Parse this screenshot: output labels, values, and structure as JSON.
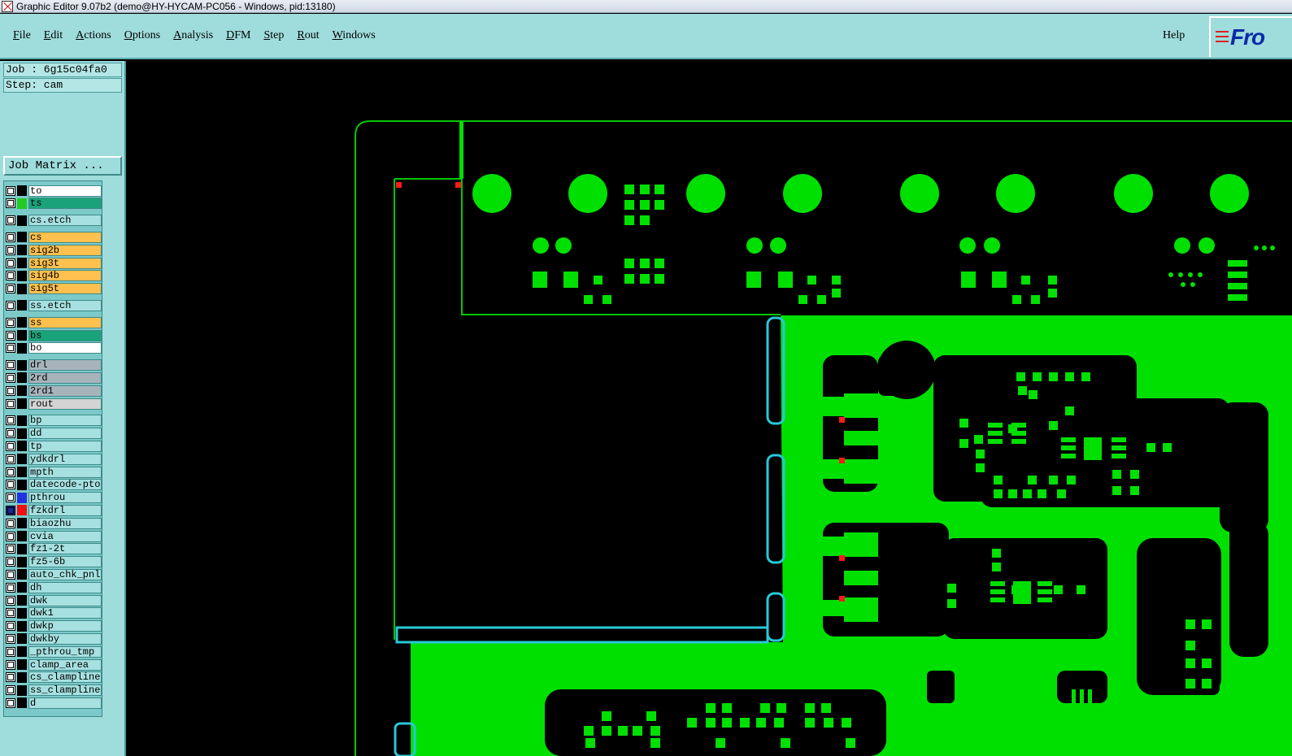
{
  "window": {
    "title": "Graphic Editor 9.07b2 (demo@HY-HYCAM-PC056 - Windows, pid:13180)"
  },
  "menu": {
    "items": [
      "File",
      "Edit",
      "Actions",
      "Options",
      "Analysis",
      "DFM",
      "Step",
      "Rout",
      "Windows"
    ],
    "help": "Help",
    "logo": "Fro"
  },
  "job": {
    "job_line": "Job : 6g15c04fa0",
    "step_line": "Step: cam",
    "matrix_button": "Job Matrix ..."
  },
  "layers": [
    {
      "name": "to",
      "swatch": "#000000",
      "bg": "#ffffff",
      "group_gap": false
    },
    {
      "name": "ts",
      "swatch": "#22cc22",
      "bg": "#1aa37a",
      "group_gap": false
    },
    {
      "name": "cs.etch",
      "swatch": "",
      "bg": "#a6e0e0",
      "group_gap": true
    },
    {
      "name": "cs",
      "swatch": "",
      "bg": "#ffc04d",
      "group_gap": true
    },
    {
      "name": "sig2b",
      "swatch": "",
      "bg": "#ffc04d",
      "group_gap": false
    },
    {
      "name": "sig3t",
      "swatch": "",
      "bg": "#ffc04d",
      "group_gap": false
    },
    {
      "name": "sig4b",
      "swatch": "",
      "bg": "#ffc04d",
      "group_gap": false
    },
    {
      "name": "sig5t",
      "swatch": "",
      "bg": "#ffc04d",
      "group_gap": false
    },
    {
      "name": "ss.etch",
      "swatch": "",
      "bg": "#a6e0e0",
      "group_gap": true
    },
    {
      "name": "ss",
      "swatch": "",
      "bg": "#ffc04d",
      "group_gap": true
    },
    {
      "name": "bs",
      "swatch": "",
      "bg": "#1aa37a",
      "group_gap": false
    },
    {
      "name": "bo",
      "swatch": "",
      "bg": "#ffffff",
      "group_gap": false
    },
    {
      "name": "drl",
      "swatch": "",
      "bg": "#a7b3bb",
      "group_gap": true
    },
    {
      "name": "2rd",
      "swatch": "",
      "bg": "#a7b3bb",
      "group_gap": false
    },
    {
      "name": "2rd1",
      "swatch": "",
      "bg": "#a7b3bb",
      "group_gap": false
    },
    {
      "name": "rout",
      "swatch": "",
      "bg": "#d4d4d4",
      "group_gap": false
    },
    {
      "name": "bp",
      "swatch": "",
      "bg": "#a6e0e0",
      "group_gap": true
    },
    {
      "name": "dd",
      "swatch": "",
      "bg": "#a6e0e0",
      "group_gap": false
    },
    {
      "name": "tp",
      "swatch": "",
      "bg": "#a6e0e0",
      "group_gap": false
    },
    {
      "name": "ydkdrl",
      "swatch": "",
      "bg": "#a6e0e0",
      "group_gap": false
    },
    {
      "name": "mpth",
      "swatch": "",
      "bg": "#a6e0e0",
      "group_gap": false
    },
    {
      "name": "datecode-pto",
      "swatch": "",
      "bg": "#a6e0e0",
      "group_gap": false
    },
    {
      "name": "pthrou",
      "swatch": "#2233dd",
      "bg": "#a6e0e0",
      "group_gap": false
    },
    {
      "name": "fzkdrl",
      "swatch": "#ee1111",
      "bg": "#a6e0e0",
      "group_gap": false,
      "active": true
    },
    {
      "name": "biaozhu",
      "swatch": "",
      "bg": "#a6e0e0",
      "group_gap": false
    },
    {
      "name": "cvia",
      "swatch": "",
      "bg": "#a6e0e0",
      "group_gap": false
    },
    {
      "name": "fz1-2t",
      "swatch": "",
      "bg": "#a6e0e0",
      "group_gap": false
    },
    {
      "name": "fz5-6b",
      "swatch": "",
      "bg": "#a6e0e0",
      "group_gap": false
    },
    {
      "name": "auto_chk_pnl",
      "swatch": "",
      "bg": "#a6e0e0",
      "group_gap": false
    },
    {
      "name": "dh",
      "swatch": "",
      "bg": "#a6e0e0",
      "group_gap": false
    },
    {
      "name": "dwk",
      "swatch": "",
      "bg": "#a6e0e0",
      "group_gap": false
    },
    {
      "name": "dwk1",
      "swatch": "",
      "bg": "#a6e0e0",
      "group_gap": false
    },
    {
      "name": "dwkp",
      "swatch": "",
      "bg": "#a6e0e0",
      "group_gap": false
    },
    {
      "name": "dwkby",
      "swatch": "",
      "bg": "#a6e0e0",
      "group_gap": false
    },
    {
      "name": "_pthrou_tmp",
      "swatch": "",
      "bg": "#a6e0e0",
      "group_gap": false
    },
    {
      "name": "clamp_area",
      "swatch": "",
      "bg": "#a6e0e0",
      "group_gap": false
    },
    {
      "name": "cs_clampline",
      "swatch": "",
      "bg": "#a6e0e0",
      "group_gap": false
    },
    {
      "name": "ss_clampline",
      "swatch": "",
      "bg": "#a6e0e0",
      "group_gap": false
    },
    {
      "name": "d",
      "swatch": "",
      "bg": "#a6e0e0",
      "group_gap": false
    }
  ],
  "colors": {
    "copper": "#00e000",
    "outline": "#00c800",
    "highlight": "#28c8d8",
    "marker": "#ff1a1a",
    "canvas": "#000000"
  }
}
